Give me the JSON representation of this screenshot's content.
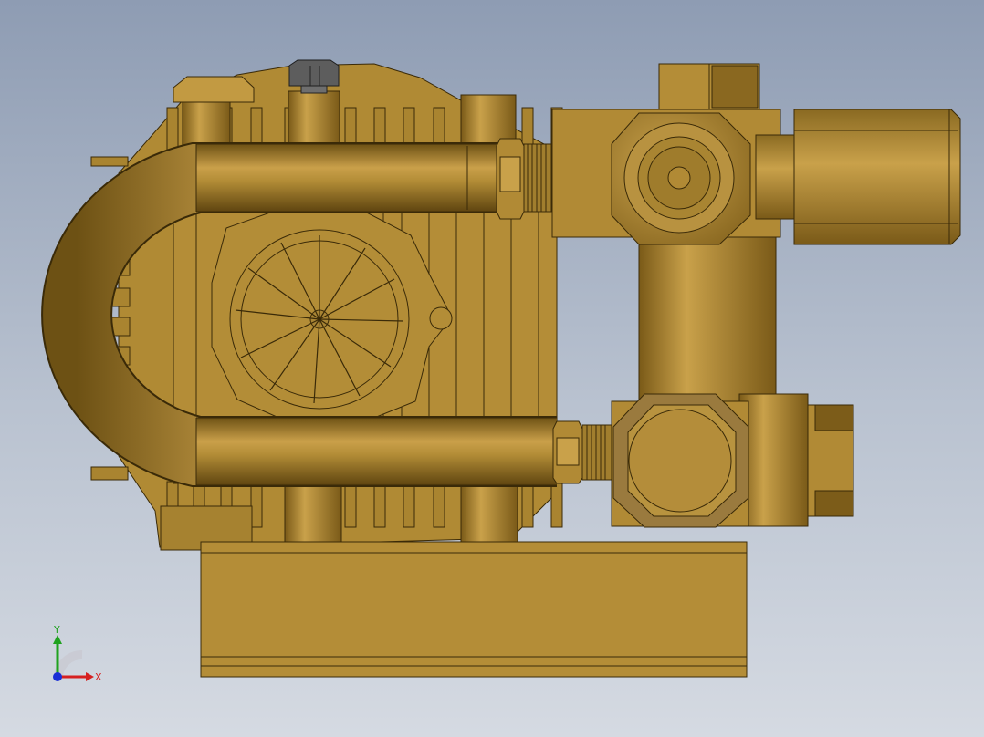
{
  "viewport": {
    "background_top": "#8e9cb3",
    "background_bottom": "#d5dae2"
  },
  "model": {
    "part_color": "#b78f37",
    "part_dark": "#7a5a18",
    "part_light": "#d8b25a",
    "edge_color": "#3a2a08"
  },
  "triad": {
    "x_label": "X",
    "y_label": "Y",
    "x_color": "#d62020",
    "y_color": "#1fa21f",
    "z_color": "#1a2fd6"
  }
}
